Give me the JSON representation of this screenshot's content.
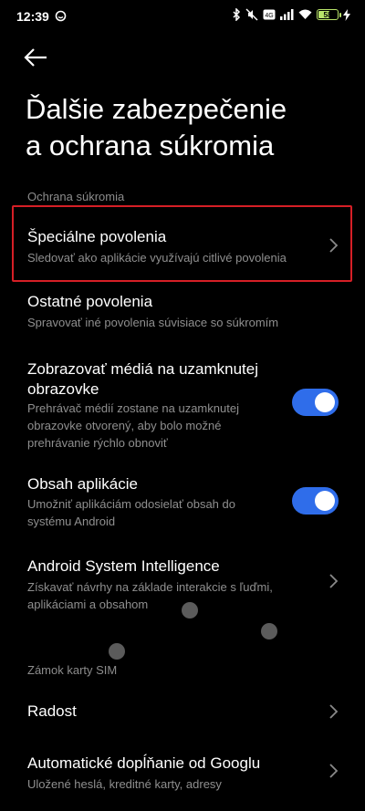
{
  "status_bar": {
    "time": "12:39",
    "battery_level": "58"
  },
  "page": {
    "title_line1": "Ďalšie zabezpečenie",
    "title_line2": "a ochrana súkromia"
  },
  "sections": {
    "privacy_header": "Ochrana súkromia",
    "sim_header": "Zámok karty SIM"
  },
  "items": {
    "special_permissions": {
      "title": "Špeciálne povolenia",
      "subtitle": "Sledovať ako aplikácie využívajú citlivé povolenia"
    },
    "other_permissions": {
      "title": "Ostatné povolenia",
      "subtitle": "Spravovať iné povolenia súvisiace so súkromím"
    },
    "lockscreen_media": {
      "title_line1": "Zobrazovať médiá na uzamknutej",
      "title_line2": "obrazovke",
      "subtitle_line1": "Prehrávač médií zostane na uzamknutej",
      "subtitle_line2": "obrazovke otvorený, aby bolo možné",
      "subtitle_line3": "prehrávanie rýchlo obnoviť",
      "enabled": true
    },
    "app_content": {
      "title": "Obsah aplikácie",
      "subtitle_line1": "Umožniť aplikáciám odosielať obsah do",
      "subtitle_line2": "systému Android",
      "enabled": true
    },
    "asi": {
      "title": "Android System Intelligence",
      "subtitle_line1": "Získavať návrhy na základe interakcie s ľuďmi,",
      "subtitle_line2": "aplikáciami a obsahom"
    },
    "radost": {
      "title": "Radost"
    },
    "google_autofill": {
      "title": "Automatické dopĺňanie od Googlu",
      "subtitle": "Uložené heslá, kreditné karty, adresy"
    }
  },
  "colors": {
    "accent": "#2f6dea",
    "highlight": "#d61f26",
    "battery": "#b9e46a"
  }
}
